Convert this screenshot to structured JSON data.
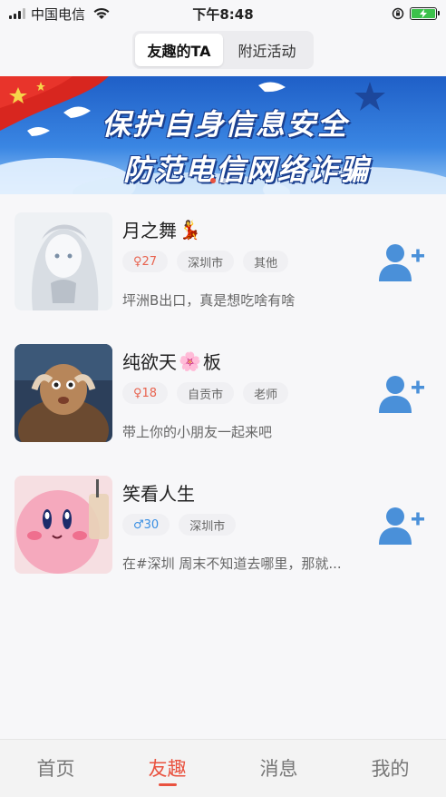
{
  "status_bar": {
    "carrier": "中国电信",
    "time": "下午8:48"
  },
  "segmented": {
    "tabs": [
      "友趣的TA",
      "附近活动"
    ],
    "active_index": 0
  },
  "banner": {
    "line1": "保护自身信息安全",
    "line2": "防范电信网络诈骗"
  },
  "users": [
    {
      "name": "月之舞",
      "emoji": "💃",
      "gender_symbol": "♀",
      "age": "27",
      "city": "深圳市",
      "occupation": "其他",
      "bio": "坪洲B出口，真是想吃啥有啥"
    },
    {
      "name": "纯欲天",
      "emoji": "🌸",
      "name_suffix": "板",
      "gender_symbol": "♀",
      "age": "18",
      "city": "自贡市",
      "occupation": "老师",
      "bio": "带上你的小朋友一起来吧"
    },
    {
      "name": "笑看人生",
      "gender_symbol": "♂",
      "age": "30",
      "city": "深圳市",
      "bio": "在#深圳 周末不知道去哪里，那就..."
    }
  ],
  "tabbar": {
    "items": [
      "首页",
      "友趣",
      "消息",
      "我的"
    ],
    "active_index": 1
  },
  "colors": {
    "accent": "#e9523f",
    "male_blue": "#3a8fe3",
    "add_icon": "#4a90d9"
  },
  "icons": {
    "add_friend": "person-add-icon",
    "wifi": "wifi-icon",
    "battery": "battery-charging-icon"
  }
}
